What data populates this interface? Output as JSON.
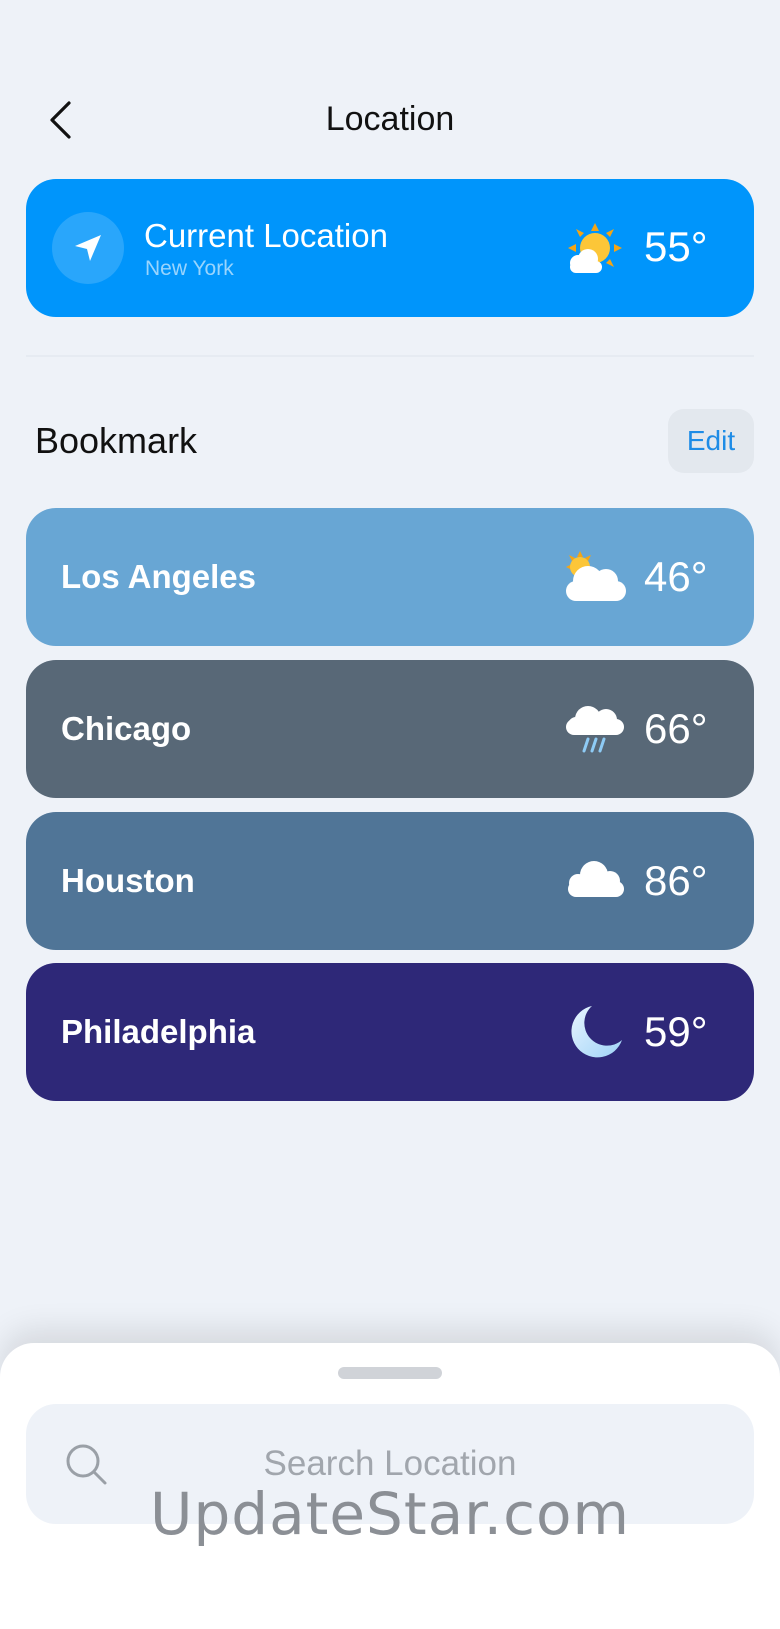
{
  "header": {
    "title": "Location",
    "back_icon": "chevron-left-icon"
  },
  "current_location": {
    "title": "Current Location",
    "city": "New York",
    "temp": "55°",
    "icon": "sun-behind-cloud-icon",
    "bg_color": "#0095fb"
  },
  "bookmarks": {
    "title": "Bookmark",
    "edit_label": "Edit",
    "items": [
      {
        "city": "Los Angeles",
        "temp": "46°",
        "icon": "partly-cloudy-icon",
        "bg_color": "#68a6d4"
      },
      {
        "city": "Chicago",
        "temp": "66°",
        "icon": "rain-cloud-icon",
        "bg_color": "#586877"
      },
      {
        "city": "Houston",
        "temp": "86°",
        "icon": "cloud-icon",
        "bg_color": "#507597"
      },
      {
        "city": "Philadelphia",
        "temp": "59°",
        "icon": "crescent-moon-icon",
        "bg_color": "#2e2878"
      }
    ]
  },
  "search": {
    "placeholder": "Search Location",
    "icon": "search-icon"
  },
  "watermark": "UpdateStar.com"
}
